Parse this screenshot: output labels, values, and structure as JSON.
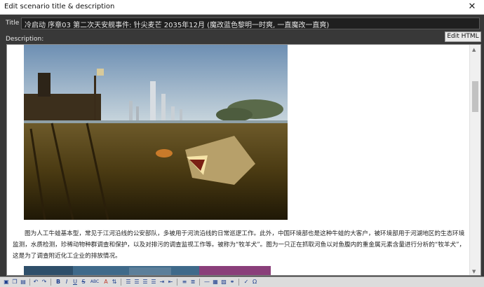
{
  "window": {
    "title": "Edit scenario title & description",
    "close_glyph": "✕"
  },
  "fields": {
    "title_label": "Title",
    "title_value": "冷启动 序章03 第二次天安舰事件: 针尖麦芒 2035年12月 (魔改蓝色黎明一时爽, 一直魔改一直爽)",
    "description_label": "Description:",
    "edit_html_label": "Edit HTML"
  },
  "description": {
    "paragraph": "图为人工牛蛙基本型，常见于江河沿线的公安部队，多被用于河流沿线的日常巡逻工作。此外，中国环境部也是这种牛蛙的大客户，被环境部用于河湖地区的生态环境监测，水质检测，珍稀动物种群调查和保护，以及对排污的调查监视工作等。被称为“牧羊犬”。图为一只正在抓取河鱼以对鱼腹内的重金属元素含量进行分析的“牧羊犬”，这是为了调查附近化工企业的排放情况。",
    "image1_icon": "shark-photo-icon",
    "image2_icon": "coral-photo-icon"
  },
  "toolbar": {
    "icons": [
      "select-all-icon",
      "copy-icon",
      "paste-icon",
      "undo-icon",
      "redo-icon",
      "bold-icon",
      "italic-icon",
      "underline-icon",
      "strike-icon",
      "abc-icon",
      "font-color-icon",
      "sort-icon",
      "align-left-icon",
      "align-center-icon",
      "align-right-icon",
      "justify-icon",
      "indent-icon",
      "outdent-icon",
      "bullets-icon",
      "numbering-icon",
      "hr-icon",
      "table-icon",
      "image-icon",
      "link-icon",
      "spell-icon",
      "symbol-icon"
    ],
    "labels": {
      "bold": "B",
      "italic": "I",
      "underline": "U",
      "strike": "S",
      "abc": "ABC"
    }
  },
  "colors": {
    "window_bg": "#383838",
    "editor_bg": "#ffffff",
    "toolbar_accent": "#1e3f8f"
  }
}
